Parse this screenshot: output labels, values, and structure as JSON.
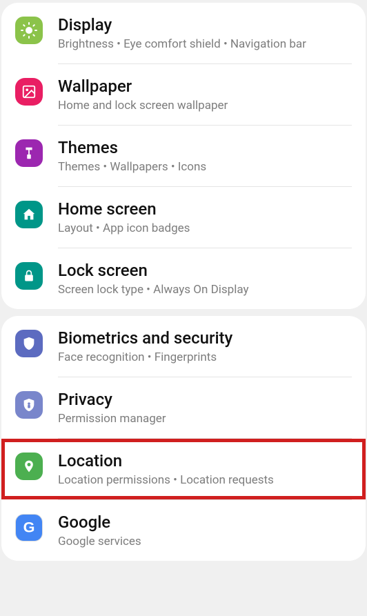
{
  "sections": [
    {
      "items": [
        {
          "title": "Display",
          "subtitle": "Brightness  •  Eye comfort shield  •  Navigation bar"
        },
        {
          "title": "Wallpaper",
          "subtitle": "Home and lock screen wallpaper"
        },
        {
          "title": "Themes",
          "subtitle": "Themes  •  Wallpapers  •  Icons"
        },
        {
          "title": "Home screen",
          "subtitle": "Layout  •  App icon badges"
        },
        {
          "title": "Lock screen",
          "subtitle": "Screen lock type  •  Always On Display"
        }
      ]
    },
    {
      "items": [
        {
          "title": "Biometrics and security",
          "subtitle": "Face recognition  •  Fingerprints"
        },
        {
          "title": "Privacy",
          "subtitle": "Permission manager"
        },
        {
          "title": "Location",
          "subtitle": "Location permissions  •  Location requests"
        },
        {
          "title": "Google",
          "subtitle": "Google services"
        }
      ]
    }
  ]
}
